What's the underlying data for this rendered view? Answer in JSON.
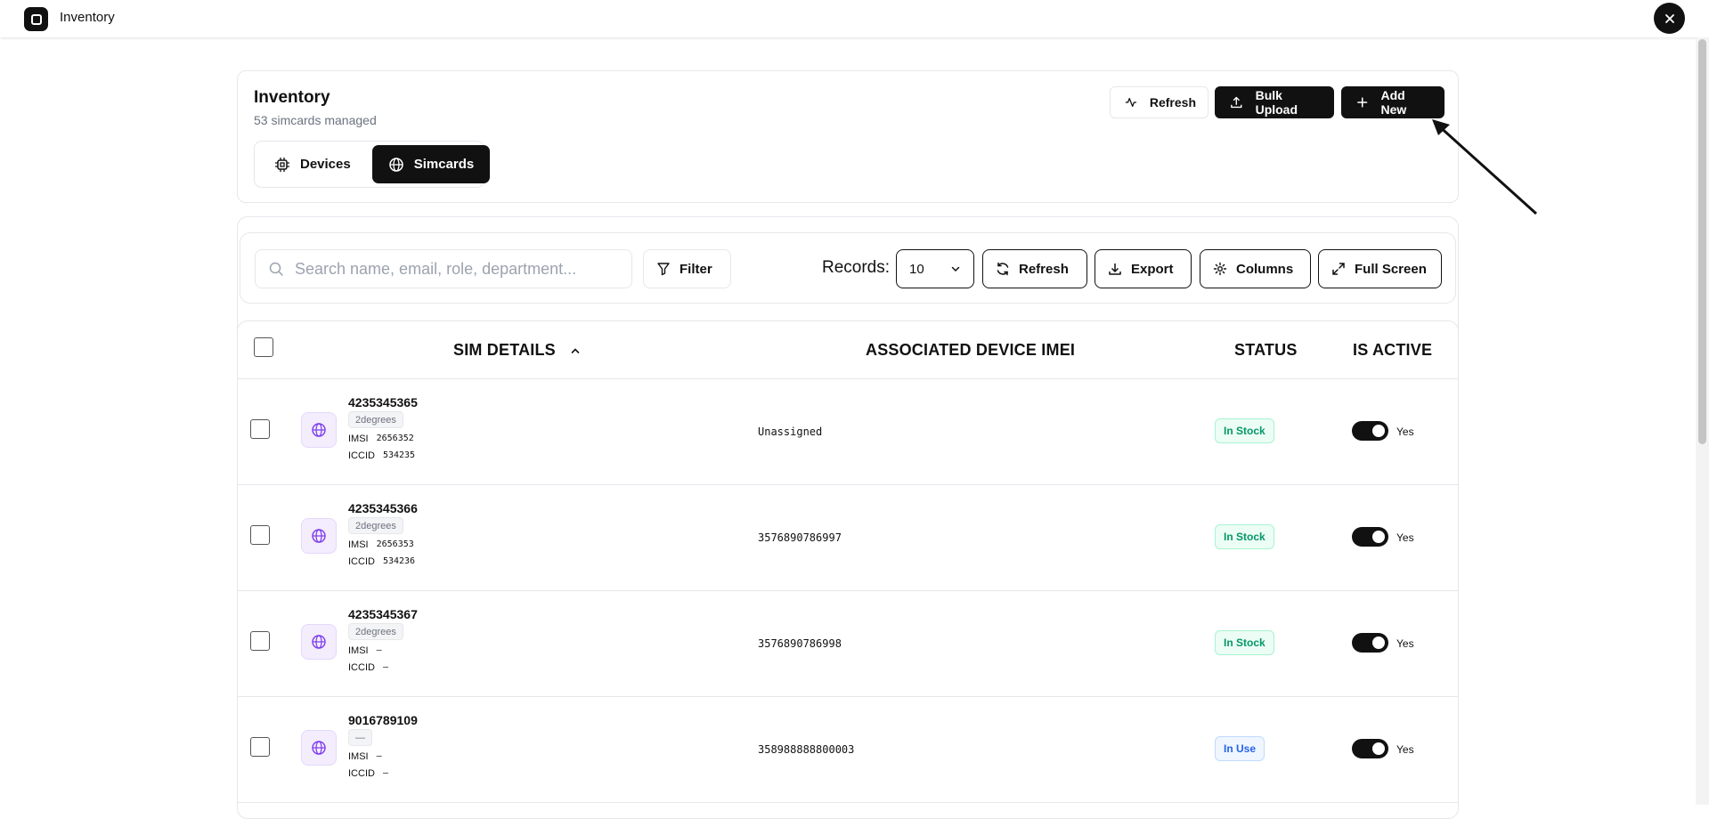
{
  "app": {
    "title": "Inventory"
  },
  "header": {
    "title": "Inventory",
    "subtitle": "53 simcards managed",
    "tabs": [
      {
        "label": "Devices",
        "active": false
      },
      {
        "label": "Simcards",
        "active": true
      }
    ],
    "buttons": {
      "refresh": "Refresh",
      "bulk_upload": "Bulk Upload",
      "add_new": "Add New"
    }
  },
  "toolbar": {
    "search_placeholder": "Search name, email, role, department...",
    "filter": "Filter",
    "records_label": "Records:",
    "records_value": "10",
    "refresh": "Refresh",
    "export": "Export",
    "columns": "Columns",
    "full_screen": "Full Screen"
  },
  "table": {
    "headers": {
      "sim": "SIM DETAILS",
      "imei": "ASSOCIATED DEVICE IMEI",
      "status": "STATUS",
      "active": "IS ACTIVE"
    },
    "rows": [
      {
        "number": "4235345365",
        "carrier": "2degrees",
        "imsi_label": "IMSI",
        "imsi": "2656352",
        "iccid_label": "ICCID",
        "iccid": "534235",
        "imei": "Unassigned",
        "status": "In Stock",
        "active": "Yes"
      },
      {
        "number": "4235345366",
        "carrier": "2degrees",
        "imsi_label": "IMSI",
        "imsi": "2656353",
        "iccid_label": "ICCID",
        "iccid": "534236",
        "imei": "3576890786997",
        "status": "In Stock",
        "active": "Yes"
      },
      {
        "number": "4235345367",
        "carrier": "2degrees",
        "imsi_label": "IMSI",
        "imsi": "–",
        "iccid_label": "ICCID",
        "iccid": "–",
        "imei": "3576890786998",
        "status": "In Stock",
        "active": "Yes"
      },
      {
        "number": "9016789109",
        "carrier": "—",
        "imsi_label": "IMSI",
        "imsi": "–",
        "iccid_label": "ICCID",
        "iccid": "–",
        "imei": "358988888800003",
        "status": "In Use",
        "active": "Yes"
      }
    ]
  },
  "colors": {
    "primary": "#111111",
    "in_stock": "#059669",
    "in_use": "#2563eb",
    "sim_icon": "#7c3aed"
  }
}
